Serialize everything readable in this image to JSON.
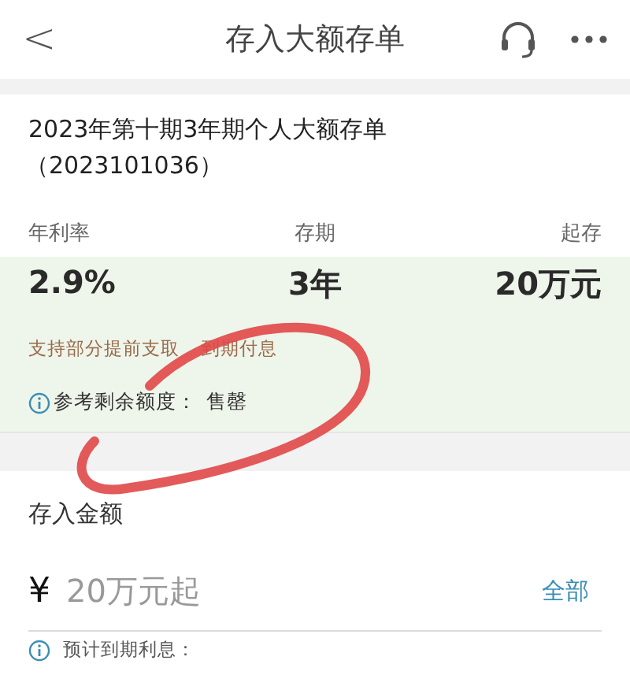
{
  "header": {
    "back_icon": "<",
    "title": "存入大额存单"
  },
  "product": {
    "name": "2023年第十期3年期个人大额存单",
    "code": "（2023101036）"
  },
  "terms": [
    {
      "label": "年利率",
      "value": "2.9%"
    },
    {
      "label": "存期",
      "value": "3年"
    },
    {
      "label": "起存",
      "value": "20万元"
    }
  ],
  "features": [
    "支持部分提前支取",
    "到期付息"
  ],
  "quota": {
    "label": "参考剩余额度：",
    "value": "售罄"
  },
  "deposit": {
    "label": "存入金额",
    "currency": "¥",
    "placeholder": "20万元起",
    "all_link": "全部",
    "note": "预计到期利息："
  }
}
